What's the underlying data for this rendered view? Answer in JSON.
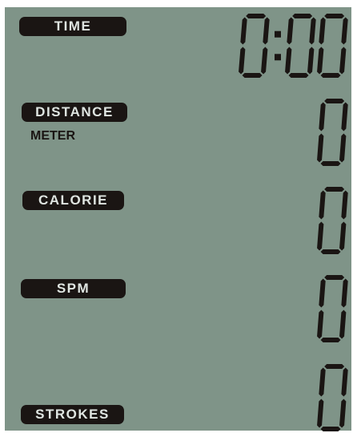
{
  "display": {
    "time": {
      "label": "TIME",
      "value": "0:00"
    },
    "distance": {
      "label": "DISTANCE",
      "unit": "METER",
      "value": "0"
    },
    "calorie": {
      "label": "CALORIE",
      "value": "0"
    },
    "spm": {
      "label": "SPM",
      "value": "0"
    },
    "strokes": {
      "label": "STROKES",
      "value": "0"
    }
  },
  "colors": {
    "lcd_background": "#7f9488",
    "segment": "#1a1513",
    "label_background": "#1a1513",
    "label_text": "#dfe5e1"
  }
}
